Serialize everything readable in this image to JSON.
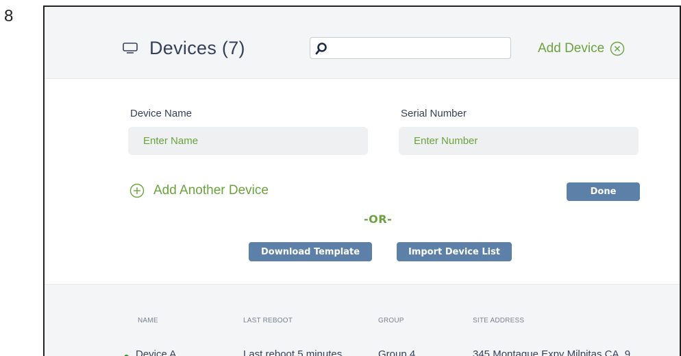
{
  "page_number": "8",
  "header": {
    "title": "Devices (7)",
    "search_placeholder": "",
    "add_device_label": "Add Device"
  },
  "form": {
    "device_name_label": "Device Name",
    "device_name_placeholder": "Enter Name",
    "serial_number_label": "Serial Number",
    "serial_number_placeholder": "Enter Number",
    "add_another_label": "Add Another Device",
    "done_label": "Done",
    "or_label": "-OR-",
    "download_template_label": "Download Template",
    "import_list_label": "Import Device List"
  },
  "table": {
    "columns": [
      "NAME",
      "LAST REBOOT",
      "GROUP",
      "SITE ADDRESS"
    ],
    "rows": [
      {
        "name": "Device A",
        "last_reboot": "Last reboot 5 minutes",
        "group": "Group 4",
        "site_address": "345 Montague Expy Milpitas CA, 9",
        "status_color": "#3a9a3a"
      }
    ]
  },
  "colors": {
    "accent_green": "#6aa33d",
    "button_blue": "#5c80a8",
    "text_navy": "#34405a"
  }
}
